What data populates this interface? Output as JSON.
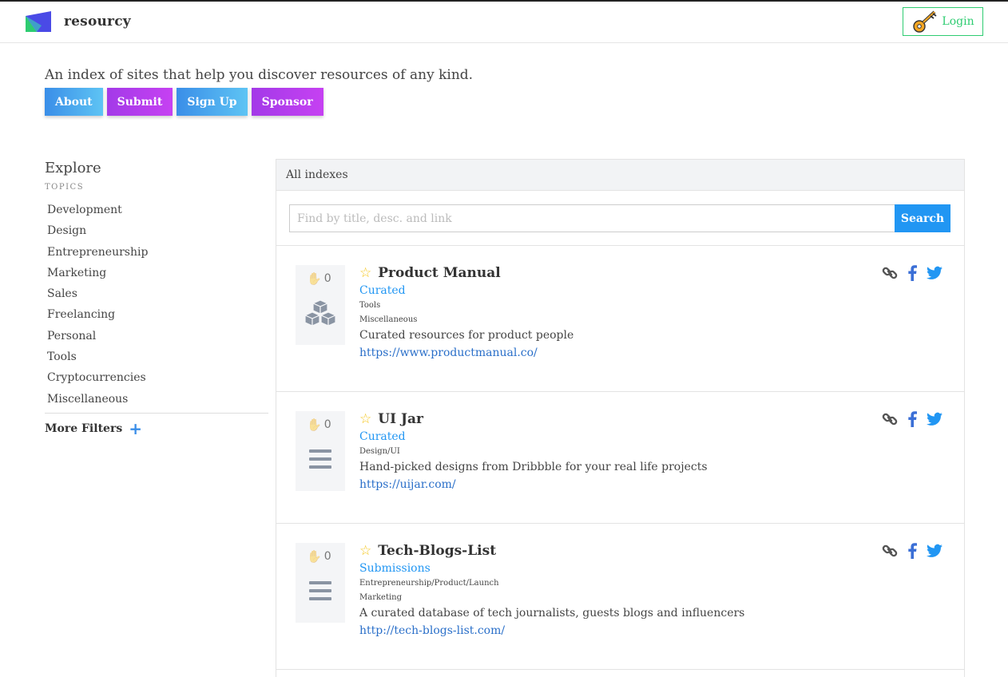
{
  "brand": {
    "name": "resourcy"
  },
  "header": {
    "login_label": "Login"
  },
  "hero": {
    "tagline": "An index of sites that help you discover resources of any kind.",
    "buttons": [
      {
        "label": "About"
      },
      {
        "label": "Submit"
      },
      {
        "label": "Sign Up"
      },
      {
        "label": "Sponsor"
      }
    ]
  },
  "sidebar": {
    "title": "Explore",
    "topics_label": "TOPICS",
    "topics": [
      "Development",
      "Design",
      "Entrepreneurship",
      "Marketing",
      "Sales",
      "Freelancing",
      "Personal",
      "Tools",
      "Cryptocurrencies",
      "Miscellaneous"
    ],
    "more_filters": "More Filters",
    "more_filters_icon": "plus-icon"
  },
  "panel": {
    "heading": "All indexes",
    "search": {
      "placeholder": "Find by title, desc. and link",
      "value": "",
      "button": "Search"
    },
    "items": [
      {
        "votes": "0",
        "icon": "cubes-icon",
        "title": "Product Manual",
        "category": "Curated",
        "tags": [
          "Tools",
          "Miscellaneous"
        ],
        "description": "Curated resources for product people",
        "url": "https://www.productmanual.co/"
      },
      {
        "votes": "0",
        "icon": "list-icon",
        "title": "UI Jar",
        "category": "Curated",
        "tags": [
          "Design/UI"
        ],
        "description": "Hand-picked designs from Dribbble for your real life projects",
        "url": "https://uijar.com/"
      },
      {
        "votes": "0",
        "icon": "list-icon",
        "title": "Tech-Blogs-List",
        "category": "Submissions",
        "tags": [
          "Entrepreneurship/Product/Launch",
          "Marketing"
        ],
        "description": "A curated database of tech journalists, guests blogs and influencers",
        "url": "http://tech-blogs-list.com/"
      }
    ]
  },
  "colors": {
    "accent_blue": "#2196f3",
    "login_green": "#2ecc71",
    "star_yellow": "#f5c518",
    "link_blue": "#2a6fc9"
  }
}
